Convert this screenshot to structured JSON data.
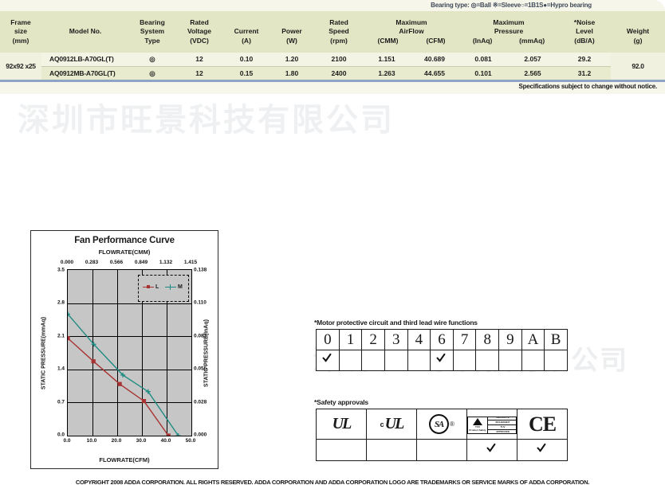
{
  "spec": {
    "bearing_legend": "Bearing type:  ◎=Ball ※=Sleeve○=1B1S●=Hypro bearing",
    "note": "Specifications subject to change without notice.",
    "headers": {
      "frame_size": [
        "Frame",
        "size",
        "(mm)"
      ],
      "model_no": [
        "Model No."
      ],
      "bearing_type": [
        "Bearing",
        "System",
        "Type"
      ],
      "rated_voltage": [
        "Rated",
        "Voltage",
        "(VDC)"
      ],
      "current": [
        "Current",
        "(A)"
      ],
      "power": [
        "Power",
        "(W)"
      ],
      "rated_speed": [
        "Rated",
        "Speed",
        "(rpm)"
      ],
      "airflow": [
        "Maximum",
        "AirFlow"
      ],
      "airflow_cmm": "(CMM)",
      "airflow_cfm": "(CFM)",
      "pressure": [
        "Maximum",
        "Pressure"
      ],
      "pressure_inaq": "(InAq)",
      "pressure_mmaq": "(mmAq)",
      "noise": [
        "*Noise",
        "Level",
        "(dB/A)"
      ],
      "weight": [
        "Weight",
        "(g)"
      ]
    },
    "frame_size": "92x92 x25",
    "weight": "92.0",
    "rows": [
      {
        "model": "AQ0912LB-A70GL(T)",
        "bearing": "◎",
        "voltage": "12",
        "current": "0.10",
        "power": "1.20",
        "speed": "2100",
        "cmm": "1.151",
        "cfm": "40.689",
        "inaq": "0.081",
        "mmaq": "2.057",
        "noise": "29.2"
      },
      {
        "model": "AQ0912MB-A70GL(T)",
        "bearing": "◎",
        "voltage": "12",
        "current": "0.15",
        "power": "1.80",
        "speed": "2400",
        "cmm": "1.263",
        "cfm": "44.655",
        "inaq": "0.101",
        "mmaq": "2.565",
        "noise": "31.2"
      }
    ]
  },
  "watermark": {
    "text": "深圳市旺景科技有限公司",
    "text2": "深圳市旺景科技有限公司"
  },
  "chart_data": {
    "type": "line",
    "title": "Fan Performance Curve",
    "top_axis_label": "FLOWRATE(CMM)",
    "xlabel": "FLOWRATE(CFM)",
    "ylabel": "STATIC PRESSURE(mmAq)",
    "y2label": "STATIC PRESSURE(InAq)",
    "xlim": [
      0.0,
      50.0
    ],
    "ylim": [
      0.0,
      3.5
    ],
    "y2lim": [
      0.0,
      0.138
    ],
    "x_ticks": [
      "0.0",
      "10.0",
      "20.0",
      "30.0",
      "40.0",
      "50.0"
    ],
    "x_top_ticks": [
      "0.000",
      "0.283",
      "0.566",
      "0.849",
      "1.132",
      "1.415"
    ],
    "y_ticks": [
      "0.0",
      "0.7",
      "1.4",
      "2.1",
      "2.8",
      "3.5"
    ],
    "y2_ticks": [
      "0.000",
      "0.028",
      "0.055",
      "0.083",
      "0.110",
      "0.138"
    ],
    "grid": true,
    "legend_position": "top-right",
    "series": [
      {
        "name": "L",
        "color": "#a83232",
        "marker": "square",
        "points": [
          [
            0.0,
            2.06
          ],
          [
            10.4,
            1.57
          ],
          [
            21.0,
            1.09
          ],
          [
            30.8,
            0.73
          ],
          [
            40.7,
            0.0
          ]
        ]
      },
      {
        "name": "M",
        "color": "#1f8c83",
        "marker": "cross",
        "points": [
          [
            0.0,
            2.57
          ],
          [
            10.5,
            1.93
          ],
          [
            22.3,
            1.28
          ],
          [
            32.5,
            0.93
          ],
          [
            44.7,
            0.0
          ]
        ]
      }
    ]
  },
  "motor": {
    "title": "*Motor protective circuit and third lead wire functions",
    "codes": [
      "0",
      "1",
      "2",
      "3",
      "4",
      "6",
      "7",
      "8",
      "9",
      "A",
      "B"
    ],
    "checked": [
      true,
      false,
      false,
      false,
      false,
      true,
      false,
      false,
      false,
      false,
      false
    ]
  },
  "safety": {
    "title": "*Safety approvals",
    "marks": [
      {
        "name": "ul-logo",
        "label": "UL"
      },
      {
        "name": "cul-logo",
        "label": "cUL"
      },
      {
        "name": "csa-logo",
        "label": "CSA"
      },
      {
        "name": "tuv-logo",
        "label": "TUV"
      },
      {
        "name": "ce-logo",
        "label": "CE"
      }
    ],
    "checked": [
      false,
      false,
      false,
      true,
      true
    ],
    "csa_text": "SA",
    "csa_reg": "®",
    "ce_text": "CE",
    "cul_c": "c",
    "tuv_line1": "GEPRUFTE",
    "tuv_line2": "SICHERHEIT",
    "tuv_line3": "TUV",
    "tuv_line4": "APPROVED",
    "tuv_under1": "TUV",
    "tuv_under2": "Product Safety"
  },
  "footer": {
    "copyright": "COPYRIGHT 2008 ADDA CORPORATION. ALL RIGHTS RESERVED. ADDA CORPORATION AND ADDA  CORPORATION LOGO ARE TRADEMARKS OR SERVICE MARKS OF ADDA CORPORATION."
  }
}
